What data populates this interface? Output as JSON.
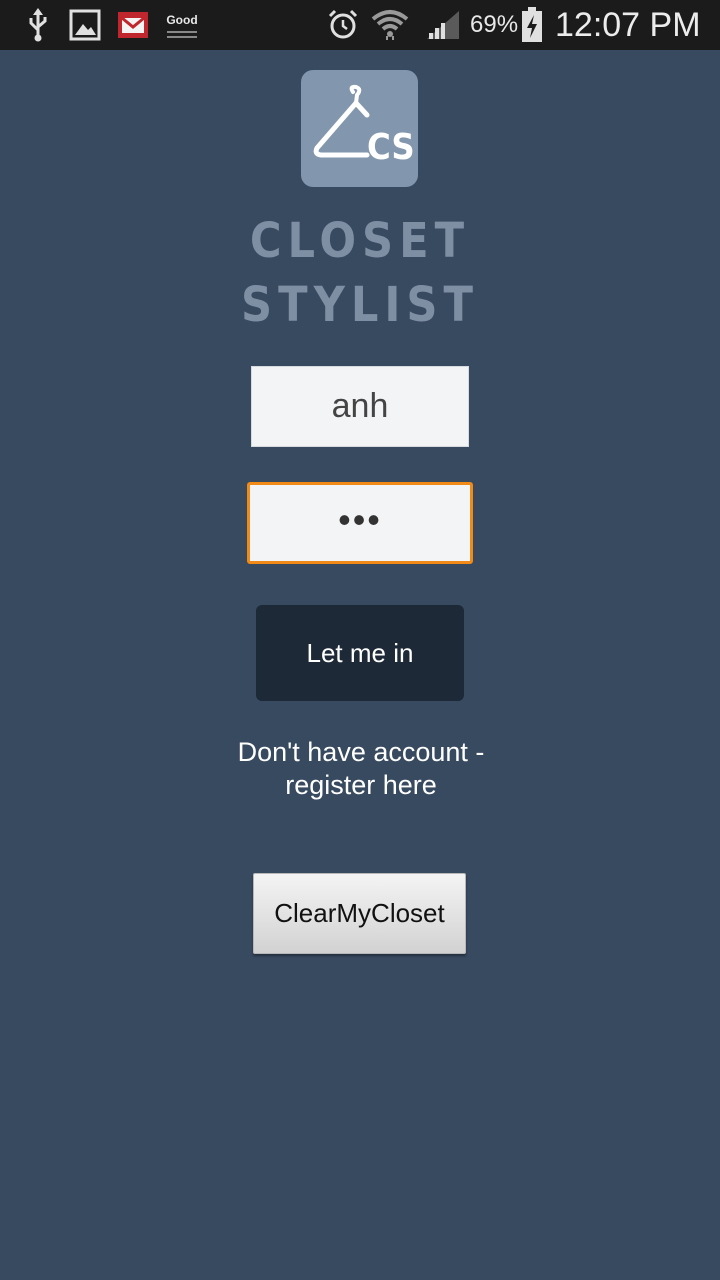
{
  "status_bar": {
    "battery": "69%",
    "time": "12:07 PM",
    "notification_label": "Good",
    "icons": [
      "usb-icon",
      "gallery-icon",
      "gmail-icon",
      "good-icon",
      "alarm-icon",
      "wifi-icon",
      "signal-icon",
      "battery-icon"
    ]
  },
  "app": {
    "logo_text": "CS",
    "brand_line1": "CLOSET",
    "brand_line2": "STYLIST"
  },
  "login": {
    "username_value": "anh",
    "password_value": "•••",
    "submit_label": "Let me in",
    "register_text": "Don't have account - register here",
    "clear_button_label": "ClearMyCloset"
  },
  "colors": {
    "background": "#384a60",
    "logo_tile": "#8296ad",
    "brand_text": "#7e8ea3",
    "focus_border": "#f28a17",
    "primary_button": "#1d2937"
  }
}
